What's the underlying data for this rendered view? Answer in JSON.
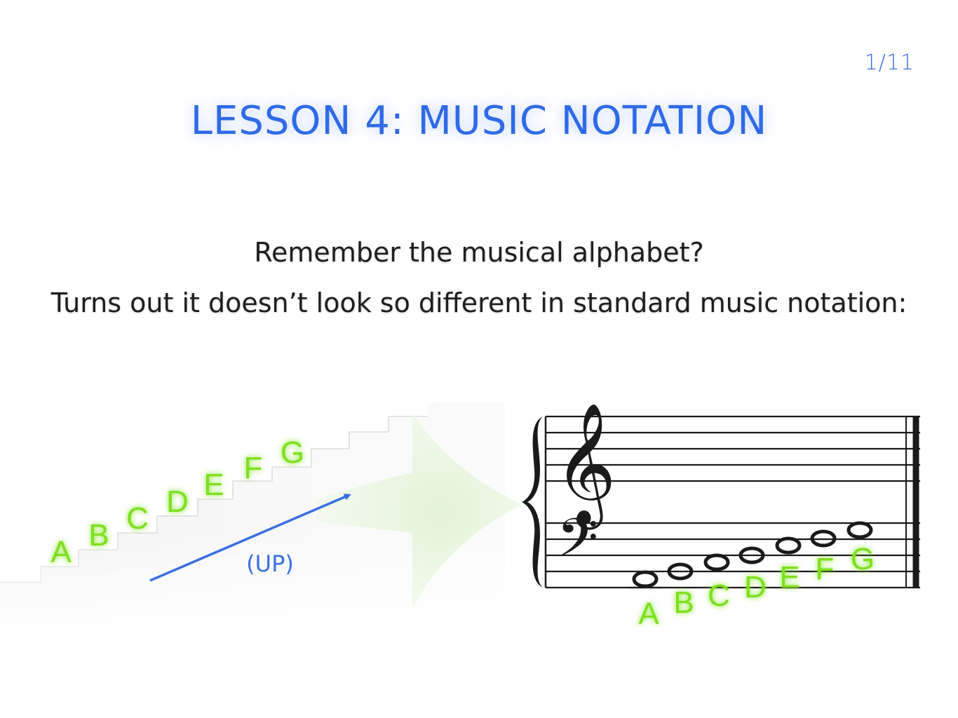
{
  "page_counter": "1/11",
  "title": "LESSON 4: MUSIC NOTATION",
  "intro": {
    "line1": "Remember the musical alphabet?",
    "line2": "Turns out it doesn’t look so different in standard music notation:"
  },
  "stairs": {
    "letters": [
      "A",
      "B",
      "C",
      "D",
      "E",
      "F",
      "G"
    ],
    "direction_label": "(UP)"
  },
  "staff": {
    "letters": [
      "A",
      "B",
      "C",
      "D",
      "E",
      "F",
      "G"
    ]
  },
  "colors": {
    "title": "#2f6ae8",
    "accent_green": "#7de01e",
    "arrow_blue": "#3a6fe0"
  }
}
